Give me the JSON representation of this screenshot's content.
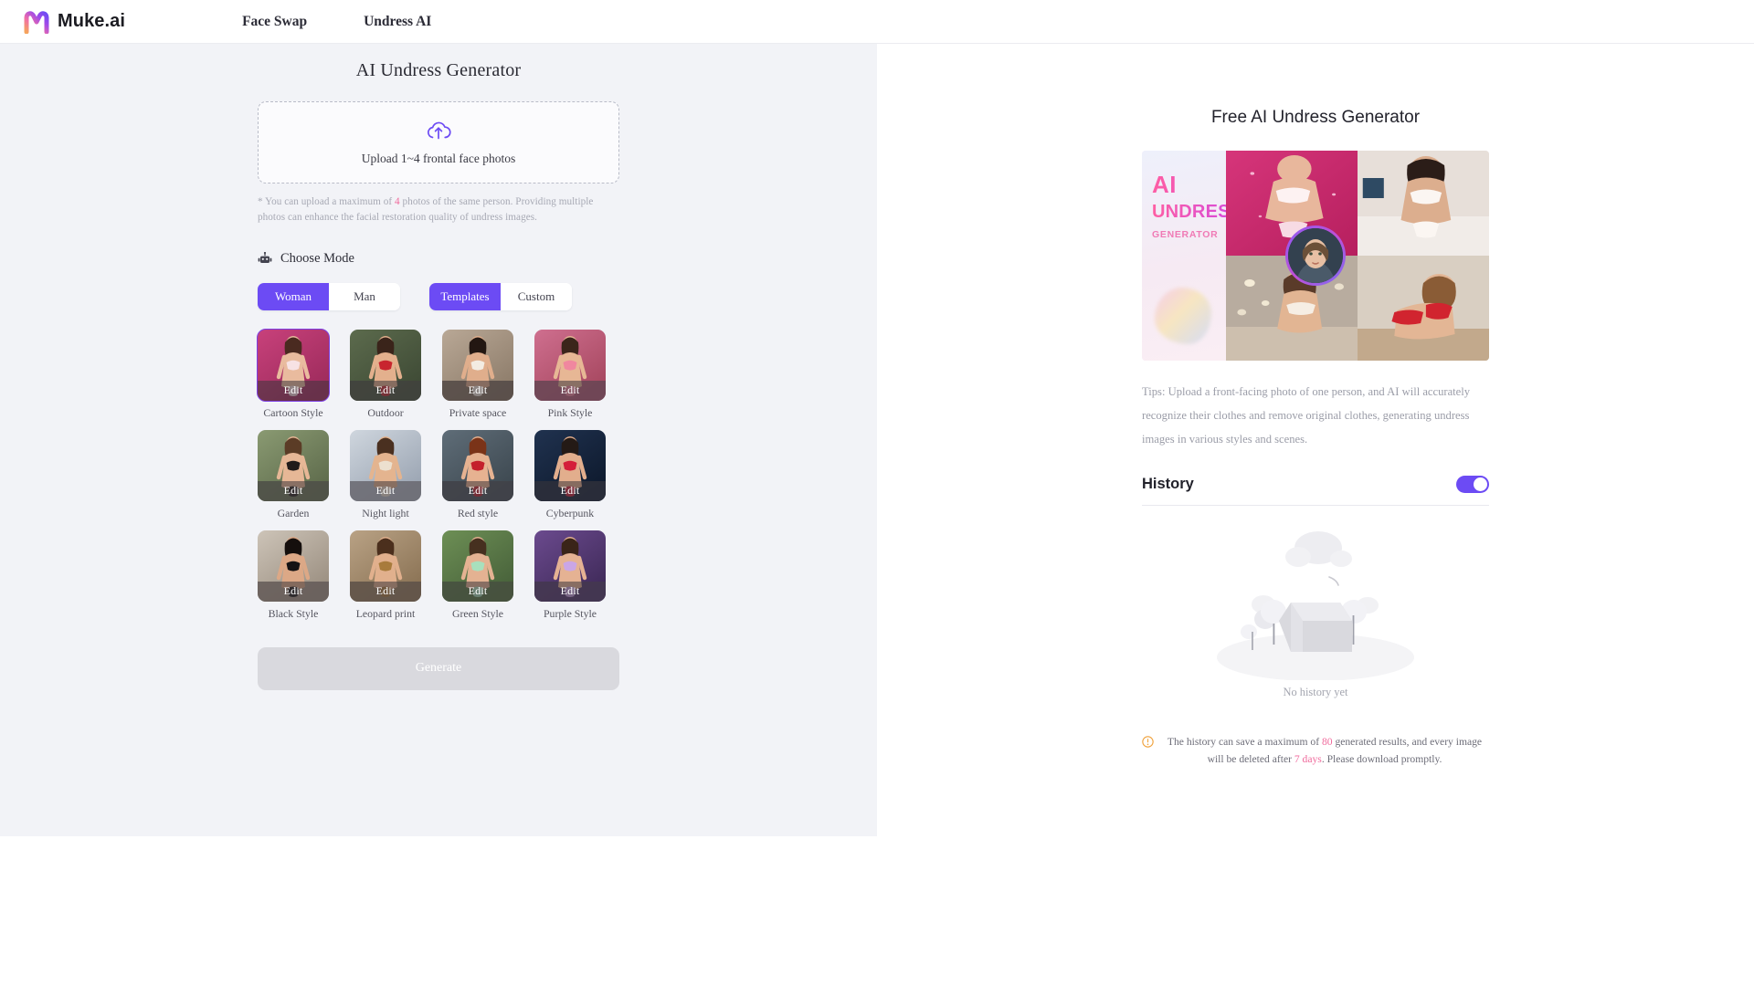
{
  "header": {
    "brand": "Muke.ai",
    "nav": [
      {
        "label": "Face Swap"
      },
      {
        "label": "Undress AI"
      }
    ]
  },
  "left": {
    "title": "AI Undress Generator",
    "upload": {
      "text": "Upload 1~4 frontal face photos",
      "icon": "cloud-upload-icon"
    },
    "note": {
      "prefix": "* You can upload a maximum of ",
      "count": "4",
      "suffix": " photos of the same person. Providing multiple photos can enhance the facial restoration quality of undress images."
    },
    "mode": {
      "icon": "robot-icon",
      "label": "Choose Mode",
      "gender": {
        "options": [
          "Woman",
          "Man"
        ],
        "selected": "Woman"
      },
      "source": {
        "options": [
          "Templates",
          "Custom"
        ],
        "selected": "Templates"
      }
    },
    "edit_label": "Edit",
    "templates": [
      {
        "label": "Cartoon Style",
        "selected": true
      },
      {
        "label": "Outdoor",
        "selected": false
      },
      {
        "label": "Private space",
        "selected": false
      },
      {
        "label": "Pink Style",
        "selected": false
      },
      {
        "label": "Garden",
        "selected": false
      },
      {
        "label": "Night light",
        "selected": false
      },
      {
        "label": "Red style",
        "selected": false
      },
      {
        "label": "Cyberpunk",
        "selected": false
      },
      {
        "label": "Black Style",
        "selected": false
      },
      {
        "label": "Leopard print",
        "selected": false
      },
      {
        "label": "Green Style",
        "selected": false
      },
      {
        "label": "Purple Style",
        "selected": false
      }
    ],
    "generate_label": "Generate"
  },
  "right": {
    "title": "Free AI Undress Generator",
    "promo": {
      "line1": "AI",
      "line2": "UNDRESS",
      "line3": "GENERATOR"
    },
    "tips": "Tips: Upload a front-facing photo of one person, and AI will accurately recognize their clothes and remove original clothes, generating undress images in various styles and scenes.",
    "history": {
      "title": "History",
      "toggle_on": true,
      "empty_text": "No history yet"
    },
    "warning": {
      "icon": "warning-circle-icon",
      "part1": "The history can save a maximum of ",
      "max": "80",
      "part2": " generated results, and every image will be deleted after ",
      "days": "7 days",
      "part3": ". Please download promptly."
    }
  },
  "colors": {
    "accent_purple": "#6c4bf4",
    "highlight_pink": "#f06a9c",
    "warn_orange": "#f0a23c",
    "left_bg": "#f2f3f7"
  }
}
